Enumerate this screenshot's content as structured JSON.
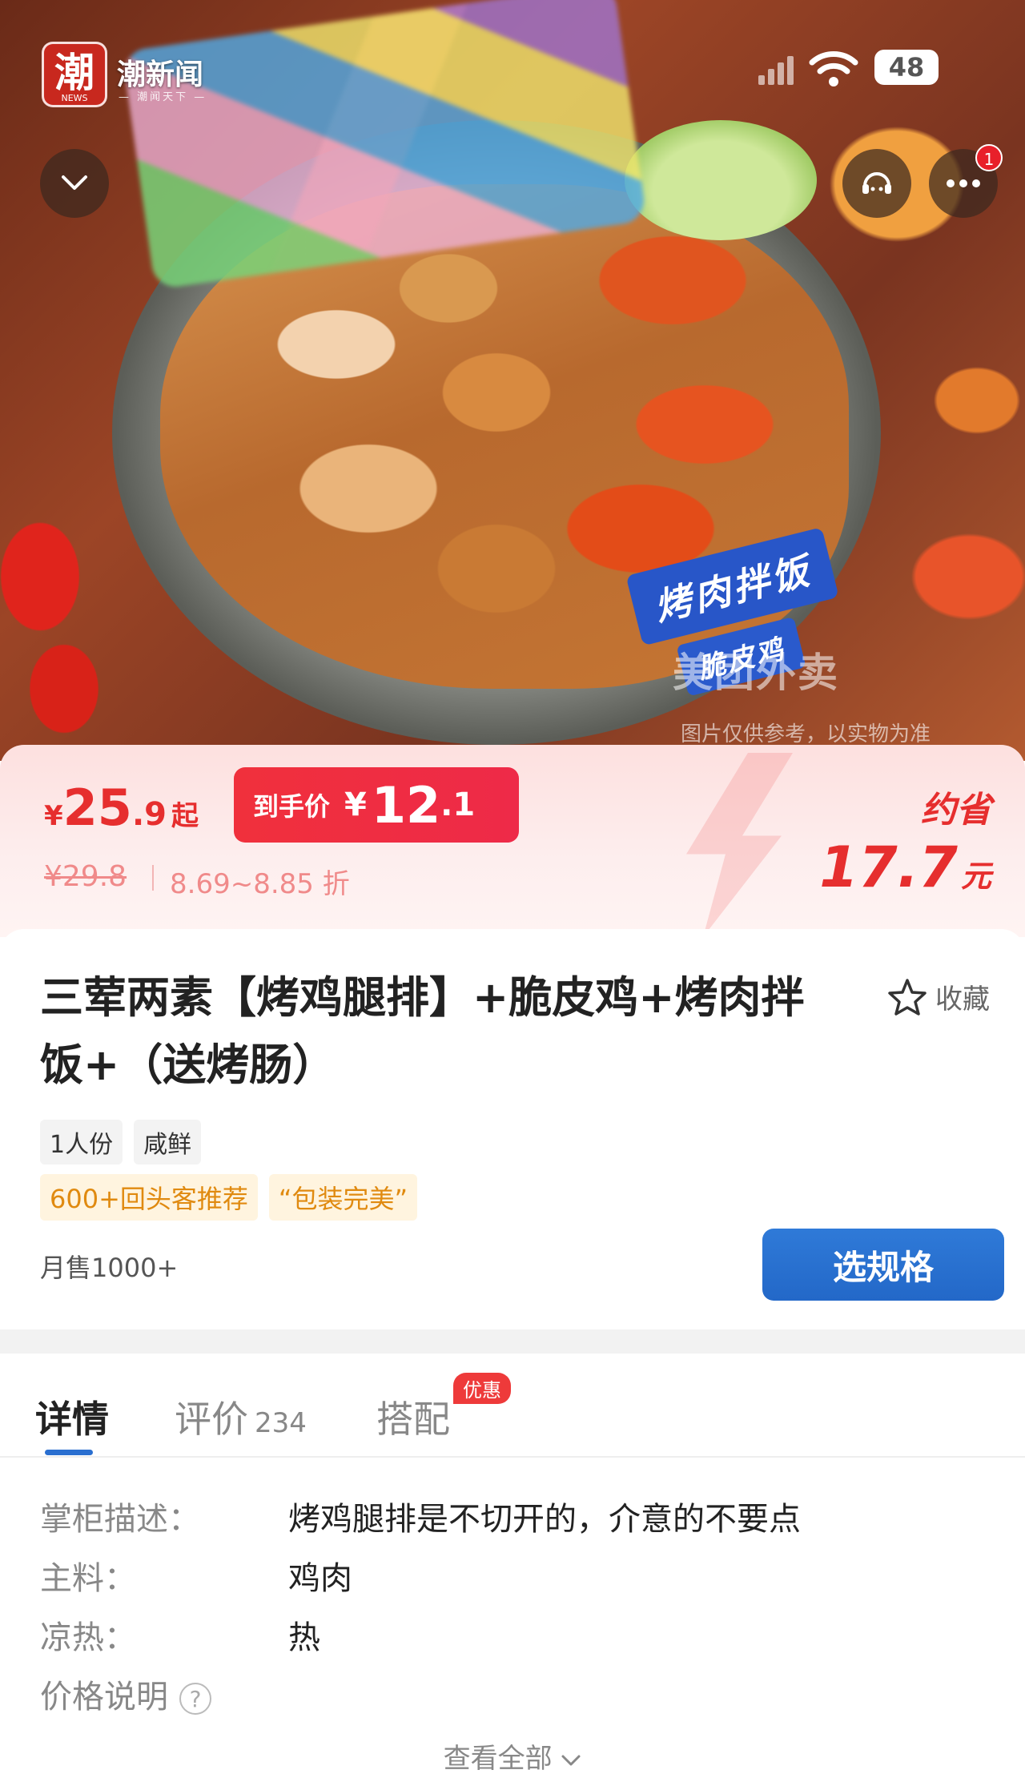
{
  "app": {
    "logo_char": "潮",
    "logo_sub": "NEWS",
    "name": "潮新闻",
    "slogan": "— 潮闻天下 —"
  },
  "status_bar": {
    "battery": "48"
  },
  "hero": {
    "sign_line1": "烤肉拌饭",
    "sign_line2": "脆皮鸡",
    "watermark": "美团外卖",
    "disclaimer": "图片仅供参考，以实物为准",
    "more_badge": "1"
  },
  "price": {
    "currency": "¥",
    "main_int": "25",
    "main_dec": ".9",
    "main_suffix": "起",
    "final_label": "到手价",
    "final_int": "12",
    "final_dec": ".1",
    "original": "¥29.8",
    "discount_range": "8.69~8.85 折",
    "save_label": "约省",
    "save_amount": "17.7",
    "save_unit": "元"
  },
  "product": {
    "title": "三荤两素【烤鸡腿排】+脆皮鸡+烤肉拌饭+（送烤肠）",
    "favorite_label": "收藏",
    "tags": [
      "1人份",
      "咸鲜"
    ],
    "highlight_tags": [
      "600+回头客推荐",
      "“包装完美”"
    ],
    "monthly_sales": "月售1000+",
    "spec_button": "选规格"
  },
  "tabs": {
    "detail": "详情",
    "reviews": "评价",
    "reviews_count": "234",
    "combo": "搭配",
    "combo_badge": "优惠"
  },
  "details": {
    "rows": [
      {
        "label": "掌柜描述：",
        "value": "烤鸡腿排是不切开的，介意的不要点"
      },
      {
        "label": "主料：",
        "value": "鸡肉"
      },
      {
        "label": "凉热：",
        "value": "热"
      }
    ],
    "price_note_label": "价格说明",
    "help_symbol": "?",
    "view_all": "查看全部"
  },
  "colors": {
    "price_red": "#e62e2e",
    "final_chip": "#f0303c",
    "spec_button_blue": "#2a6fd0",
    "highlight_tag_text": "#e08a10"
  },
  "icons": [
    "collapse-chevron-icon",
    "customer-service-icon",
    "more-dots-icon",
    "star-outline-icon",
    "help-circle-icon",
    "chevron-down-icon",
    "wifi-icon",
    "signal-icon"
  ]
}
